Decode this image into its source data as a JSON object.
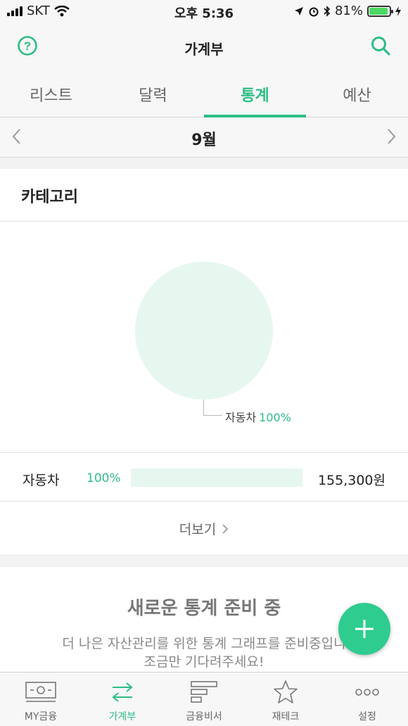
{
  "status": {
    "carrier": "SKT",
    "time": "오후 5:36",
    "battery": "81%"
  },
  "header": {
    "title": "가계부"
  },
  "tabs": [
    {
      "label": "리스트"
    },
    {
      "label": "달력"
    },
    {
      "label": "통계",
      "active": true
    },
    {
      "label": "예산"
    }
  ],
  "month": {
    "label": "9월"
  },
  "category": {
    "title": "카테고리",
    "pie_label": "자동차",
    "pie_pct": "100%",
    "row": {
      "name": "자동차",
      "pct": "100%",
      "amount": "155,300원"
    },
    "more": "더보기"
  },
  "notice": {
    "heading": "새로운 통계 준비 중",
    "line1": "더 나은 자산관리를 위한 통계 그래프를 준비중입니",
    "line2": "조금만 기다려주세요!"
  },
  "tabbar": [
    {
      "label": "MY금융",
      "icon": "money-icon"
    },
    {
      "label": "가계부",
      "icon": "transfer-icon",
      "active": true
    },
    {
      "label": "금융비서",
      "icon": "bars-icon"
    },
    {
      "label": "재테크",
      "icon": "star-icon"
    },
    {
      "label": "설정",
      "icon": "more-icon"
    }
  ],
  "colors": {
    "accent": "#2ebd85",
    "pie_fill": "#e6f7f0"
  }
}
